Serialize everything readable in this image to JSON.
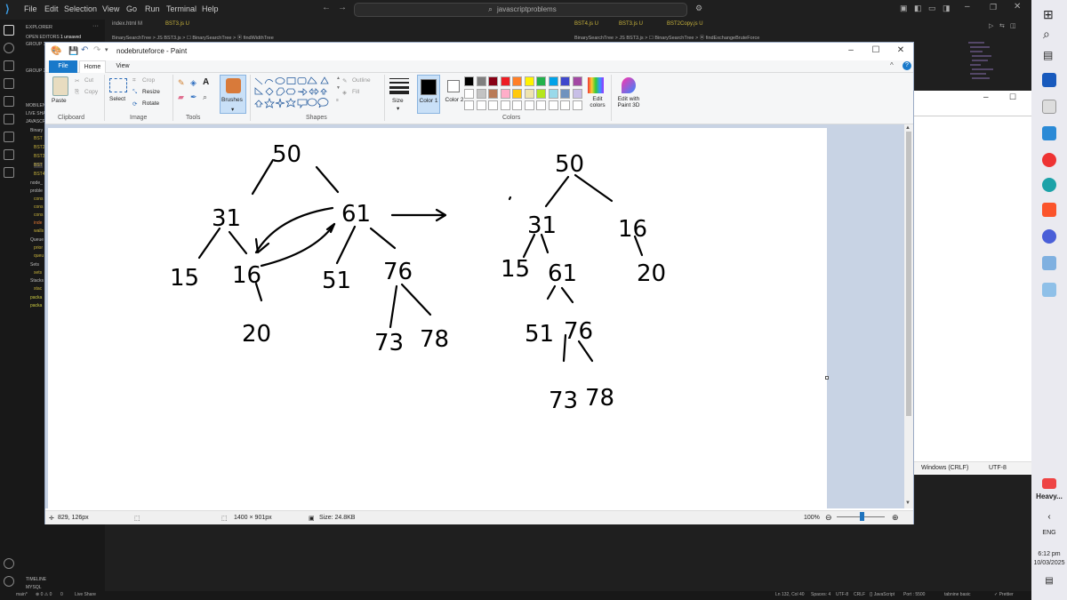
{
  "vscode": {
    "menus": [
      "File",
      "Edit",
      "Selection",
      "View",
      "Go",
      "Run",
      "Terminal",
      "Help"
    ],
    "search_placeholder": "javascriptproblems",
    "explorer_title": "EXPLORER",
    "open_editors": "OPEN EDITORS",
    "unsaved": "1 unsaved",
    "sidebar_items": [
      "GROUP 1",
      "GROUP 2",
      "JAVASCR",
      "MOBILEN",
      "LIVE SHA",
      "Binary",
      "BST",
      "BST2",
      "BST3",
      "BST",
      "BST4",
      "node_",
      "proble",
      "cons",
      "cons",
      "cons",
      "inde",
      "walls",
      "Queue",
      "prior",
      "queu",
      "Sets",
      "sets",
      "Stacks",
      "stac",
      "packa",
      "packa",
      "TIMELINE",
      "MYSQL"
    ],
    "left_tabs": [
      "index.html M",
      "BST3.js U"
    ],
    "left_crumb": "BinarySearchTree > JS BST3.js > ☐ BinarySearchTree > ⦿ findWidthTree",
    "right_tabs": [
      "BST4.js U",
      "BST3.js U",
      "BST2Copy.js U"
    ],
    "right_crumb": "BinarySearchTree > JS BST3.js > ☐ BinarySearchTree > ⦿ findExchangeBruteForce",
    "status_left": [
      "main*",
      "⊗ 0 ⚠ 0",
      "0",
      "Live Share"
    ],
    "status_right": [
      "Ln 132, Col 40",
      "Spaces: 4",
      "UTF-8",
      "CRLF",
      "{} JavaScript",
      "Port : 5500",
      "tabnine basic",
      "✓ Prettier"
    ]
  },
  "bg_window": {
    "status": [
      "Windows (CRLF)",
      "UTF-8"
    ]
  },
  "taskbar": {
    "weather": "Heavy...",
    "lang": "ENG",
    "time": "6:12 pm",
    "date": "10/03/2025"
  },
  "paint": {
    "title": "nodebruteforce - Paint",
    "tabs": {
      "file": "File",
      "home": "Home",
      "view": "View"
    },
    "clipboard": {
      "paste": "Paste",
      "cut": "Cut",
      "copy": "Copy",
      "label": "Clipboard"
    },
    "image": {
      "select": "Select",
      "crop": "Crop",
      "resize": "Resize",
      "rotate": "Rotate",
      "label": "Image"
    },
    "tools_label": "Tools",
    "brushes": "Brushes",
    "shapes": {
      "outline": "Outline",
      "fill": "Fill",
      "label": "Shapes"
    },
    "size": "Size",
    "color1": "Color 1",
    "color2": "Color 2",
    "edit_colors": "Edit colors",
    "edit_paint3d": "Edit with Paint 3D",
    "colors_label": "Colors",
    "palette_row1": [
      "#000000",
      "#7f7f7f",
      "#880015",
      "#ed1c24",
      "#ff7f27",
      "#fff200",
      "#22b14c",
      "#00a2e8",
      "#3f48cc",
      "#a349a4"
    ],
    "palette_row2": [
      "#ffffff",
      "#c3c3c3",
      "#b97a57",
      "#ffaec9",
      "#ffc90e",
      "#efe4b0",
      "#b5e61d",
      "#99d9ea",
      "#7092be",
      "#c8bfe7"
    ],
    "status": {
      "cursor": "829, 126px",
      "dimensions": "1400 × 901px",
      "size": "Size: 24.8KB",
      "zoom": "100%"
    },
    "drawing": {
      "tree1": [
        "50",
        "31",
        "61",
        "15",
        "16",
        "51",
        "76",
        "20",
        "73",
        "78"
      ],
      "tree2": [
        "50",
        "31",
        "16",
        "15",
        "61",
        "20",
        "51",
        "76",
        "73",
        "78"
      ]
    }
  }
}
